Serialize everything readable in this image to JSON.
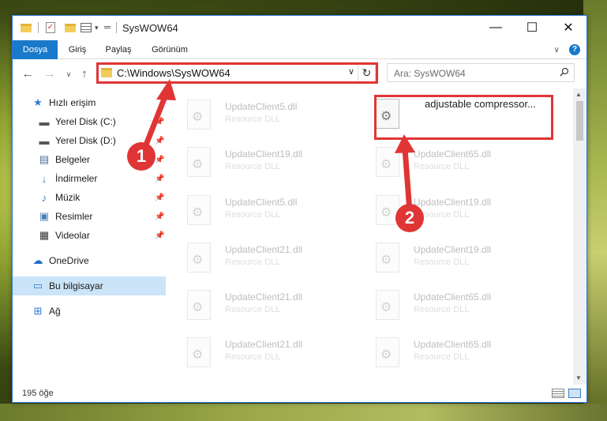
{
  "window": {
    "title": "SysWOW64"
  },
  "ribbon": {
    "tabs": [
      "Dosya",
      "Giriş",
      "Paylaş",
      "Görünüm"
    ]
  },
  "address": {
    "path": "C:\\Windows\\SysWOW64"
  },
  "search": {
    "placeholder": "Ara: SysWOW64"
  },
  "sidebar": {
    "items": [
      {
        "label": "Hızlı erişim",
        "icon": "star-icon"
      },
      {
        "label": "Yerel Disk (C:)",
        "icon": "drive-icon",
        "pinned": true
      },
      {
        "label": "Yerel Disk (D:)",
        "icon": "drive-icon",
        "pinned": true
      },
      {
        "label": "Belgeler",
        "icon": "documents-icon",
        "pinned": true
      },
      {
        "label": "İndirmeler",
        "icon": "download-icon",
        "pinned": true
      },
      {
        "label": "Müzik",
        "icon": "music-icon",
        "pinned": true
      },
      {
        "label": "Resimler",
        "icon": "pictures-icon",
        "pinned": true
      },
      {
        "label": "Videolar",
        "icon": "video-icon",
        "pinned": true
      },
      {
        "label": "OneDrive",
        "icon": "cloud-icon"
      },
      {
        "label": "Bu bilgisayar",
        "icon": "computer-icon",
        "selected": true
      },
      {
        "label": "Ağ",
        "icon": "network-icon"
      }
    ]
  },
  "files": {
    "left": [
      {
        "name": "UpdateClient5.dll",
        "desc": "Resource DLL"
      },
      {
        "name": "UpdateClient19.dll",
        "desc": "Resource DLL"
      },
      {
        "name": "UpdateClient5.dll",
        "desc": "Resource DLL"
      },
      {
        "name": "UpdateClient21.dll",
        "desc": "Resource DLL"
      },
      {
        "name": "UpdateClient21.dll",
        "desc": "Resource DLL"
      },
      {
        "name": "UpdateClient21.dll",
        "desc": "Resource DLL"
      }
    ],
    "right": [
      {
        "name": "adjustable compressor...",
        "desc": "",
        "highlighted": true
      },
      {
        "name": "UpdateClient65.dll",
        "desc": "Resource DLL"
      },
      {
        "name": "UpdateClient19.dll",
        "desc": "Resource DLL"
      },
      {
        "name": "UpdateClient19.dll",
        "desc": "Resource DLL"
      },
      {
        "name": "UpdateClient65.dll",
        "desc": "Resource DLL"
      },
      {
        "name": "UpdateClient65.dll",
        "desc": "Resource DLL"
      }
    ]
  },
  "status": {
    "count": "195 öğe"
  },
  "annotations": {
    "step1": "1",
    "step2": "2",
    "color": "#e03535"
  },
  "colors": {
    "accent": "#1979ca",
    "highlight": "#e03535",
    "selection": "#cce4f7"
  }
}
